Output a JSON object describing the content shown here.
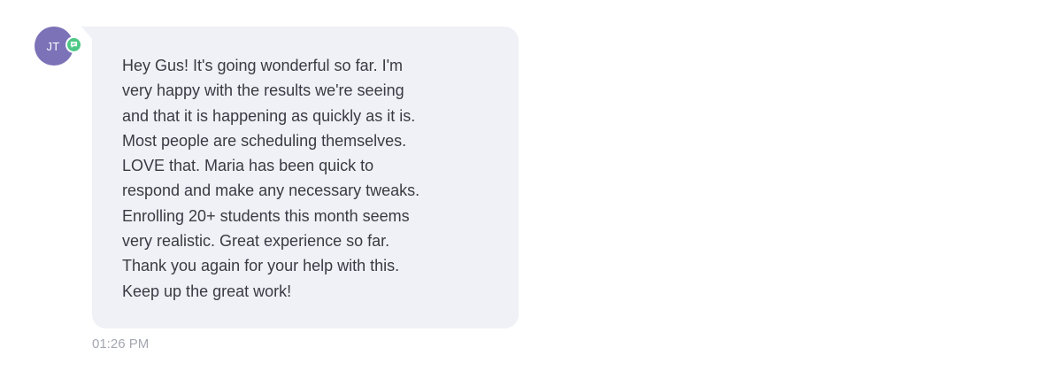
{
  "message": {
    "sender_initials": "JT",
    "channel_icon": "sms-chat-icon",
    "text": "Hey Gus! It's going wonderful so far. I'm\nvery happy with the results we're seeing\nand that it is happening as quickly as it is.\nMost people are scheduling themselves.\nLOVE that. Maria has been quick to\nrespond and make any necessary tweaks.\nEnrolling 20+ students this month seems\nvery realistic. Great experience so far.\nThank you again for your help with this.\nKeep up the great work!",
    "timestamp": "01:26 PM"
  },
  "colors": {
    "avatar_bg": "#7b72b8",
    "badge_green": "#4cc885",
    "bubble_bg": "#f0f1f6",
    "text": "#3a3a44",
    "timestamp": "#a5a7b1"
  }
}
